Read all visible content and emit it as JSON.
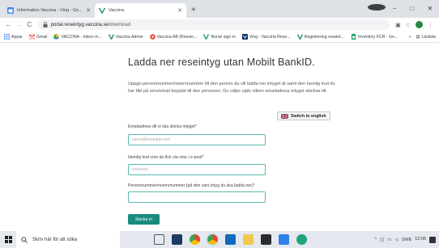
{
  "browser": {
    "tabs": [
      {
        "title": "Information Vaccina - Ving - Go...",
        "active": false
      },
      {
        "title": "Vaccina",
        "active": true
      }
    ],
    "new_tab_symbol": "+",
    "window_controls": [
      "−",
      "□",
      "✕"
    ],
    "nav": {
      "back": "←",
      "forward": "→",
      "reload": "C"
    },
    "url_host": "portal.reseintyg.vaccina.se",
    "url_path": "/download",
    "toolbar_icons": [
      "extensions-icon",
      "star-icon",
      "profile-avatar"
    ],
    "profile_letter": "C",
    "menu_symbol": "⋮",
    "bookmarks": [
      {
        "label": "Appar",
        "icon": "apps-grid-icon"
      },
      {
        "label": "Gmail",
        "icon": "gmail-icon"
      },
      {
        "label": "VACCINA - Intern m...",
        "icon": "drive-icon"
      },
      {
        "label": "Vaccina Admin",
        "icon": "vaccina-v-icon"
      },
      {
        "label": "Vaccina AB (Resein...",
        "icon": "red-circle-icon"
      },
      {
        "label": "Nurse sign in",
        "icon": "vaccina-v-icon"
      },
      {
        "label": "Ving - Vaccina Rese...",
        "icon": "ving-icon"
      },
      {
        "label": "Registrering reseint...",
        "icon": "vaccina-v-icon"
      },
      {
        "label": "Inventory FCR - Go...",
        "icon": "sheets-icon"
      }
    ],
    "bookmarks_overflow": "»",
    "reading_list": "Läslista"
  },
  "page": {
    "heading": "Ladda ner reseintyg utan Mobilt BankID.",
    "intro": "Uppge personnummer/reservnummer till den person du vill ladda ner intyget åt samt den hemlig kod du har fått på sms/email kopplat till den personen. Du väljer själv vilken emailadress intyget skickas till.",
    "switch_label": "Switch to english",
    "email_label": "Emailadress dit vi ska skicka intyget*",
    "email_placeholder": "name@example.com",
    "code_label": "Hemlig kod som du fick via sms / e-post*",
    "code_placeholder": "xxxxxxxx",
    "pnr_label": "Personnummer/reservnummer (på den vars intyg du ska ladda ner)*",
    "pnr_value": "",
    "submit_label": "Skicka in"
  },
  "taskbar": {
    "search_placeholder": "Skriv här för att söka",
    "time": "12:06",
    "tray_lang": "SWE",
    "tray_up_arrow": "^"
  },
  "colors": {
    "accent": "#1a8a7d",
    "vaccina_v": "#2e9b6c",
    "field_focus": "#5bb8b0"
  }
}
